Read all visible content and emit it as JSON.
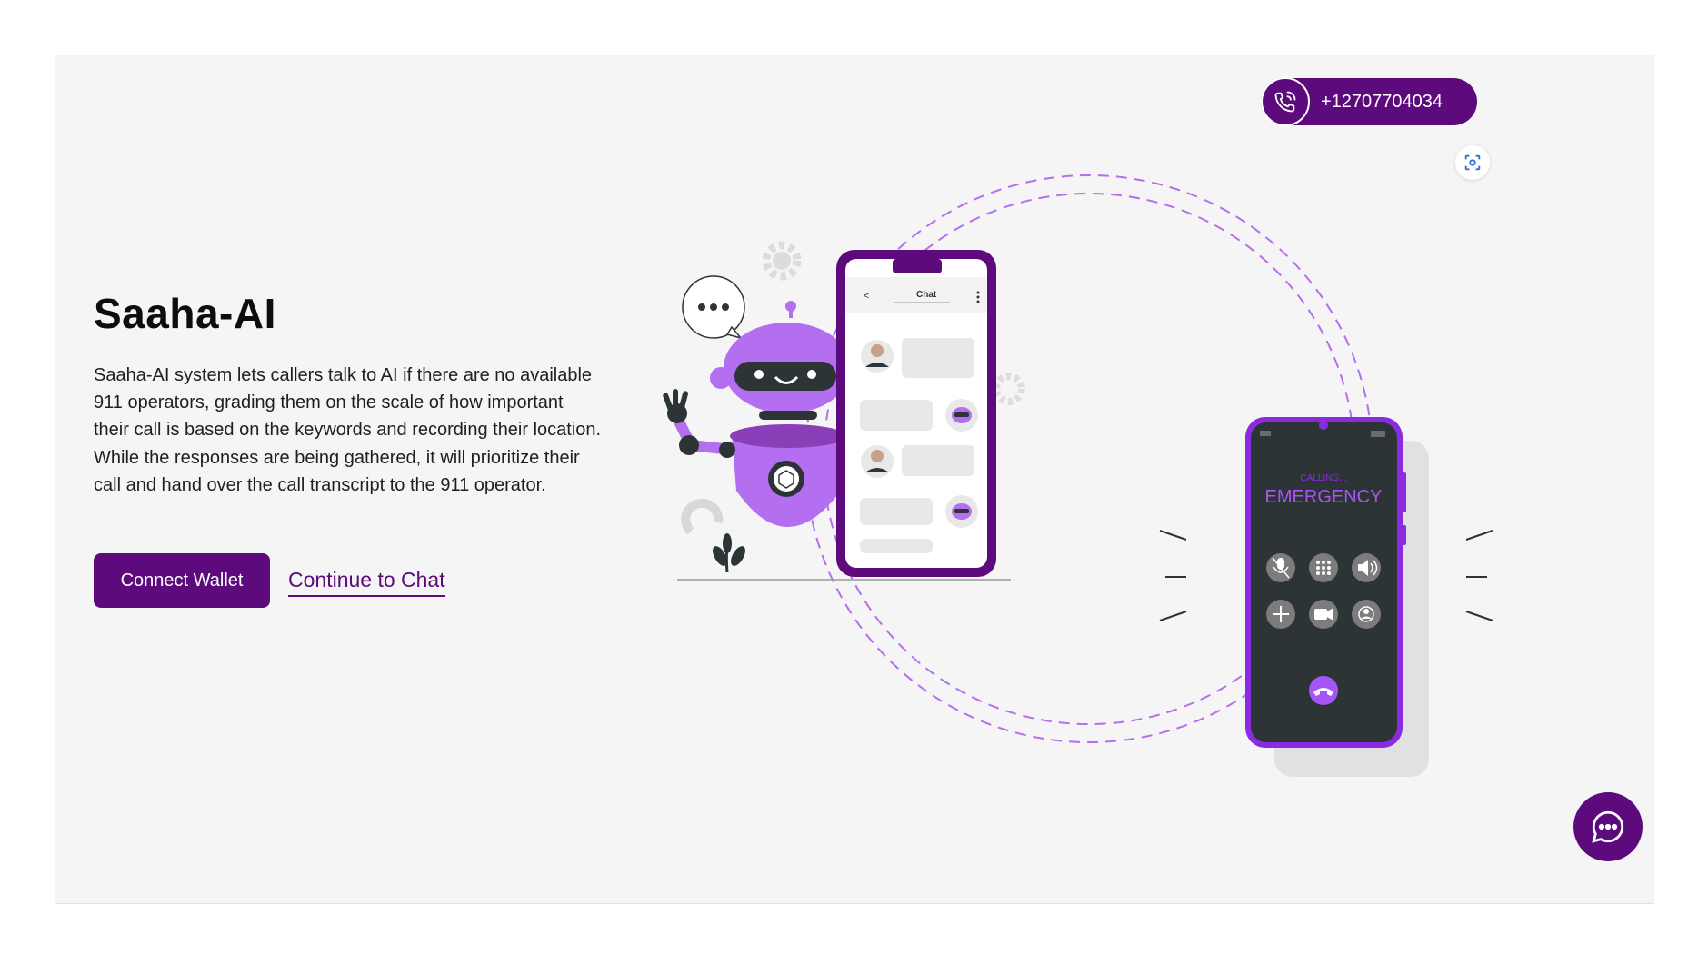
{
  "hero": {
    "title": "Saaha-AI",
    "description": "Saaha-AI system lets callers talk to AI if there are no available 911 operators, grading them on the scale of how important their call is based on the keywords and recording their location. While the responses are being gathered, it will prioritize their call and hand over the call transcript to the 911 operator.",
    "connect_wallet_label": "Connect Wallet",
    "continue_chat_label": "Continue to Chat"
  },
  "contact": {
    "phone_number": "+12707704034",
    "icon": "phone-icon"
  },
  "illustration": {
    "chat_phone_title": "Chat",
    "call_status": "CALLING...",
    "call_name": "EMERGENCY"
  },
  "floating": {
    "scan_icon": "scan-icon",
    "chat_icon": "chat-bubble-icon"
  },
  "colors": {
    "brand": "#5c0a7c",
    "accent": "#b46ef0",
    "background": "#f5f5f5"
  }
}
